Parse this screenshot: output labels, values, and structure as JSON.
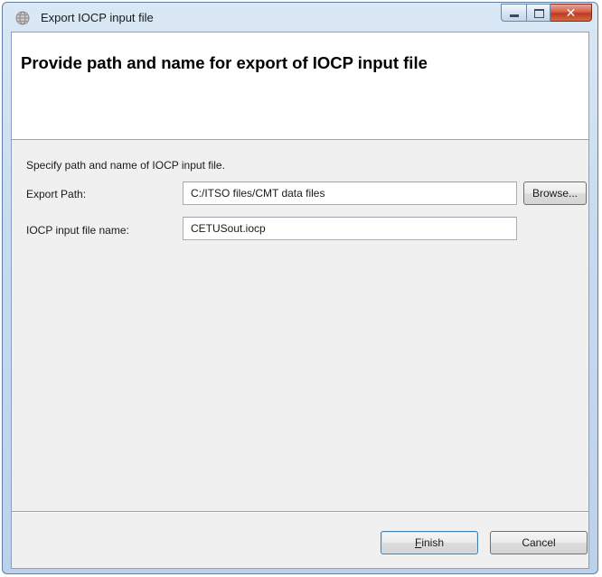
{
  "window": {
    "title": "Export IOCP input file",
    "icon": "globe-icon",
    "controls": {
      "minimize": "minimize-icon",
      "maximize": "maximize-icon",
      "close": "✕"
    }
  },
  "header": {
    "title": "Provide path and name for export of IOCP input file"
  },
  "form": {
    "instruction": "Specify path and name of IOCP input file.",
    "export_path": {
      "label": "Export Path:",
      "value": "C:/ITSO files/CMT data files"
    },
    "file_name": {
      "label": "IOCP input file name:",
      "value": "CETUSout.iocp"
    },
    "browse_label": "Browse..."
  },
  "footer": {
    "finish_mnemonic": "F",
    "finish_rest": "inish",
    "cancel_label": "Cancel"
  },
  "colors": {
    "title_bar": "#c7dbf0",
    "close_button": "#c0391f",
    "default_button_border": "#3c7fb1"
  }
}
